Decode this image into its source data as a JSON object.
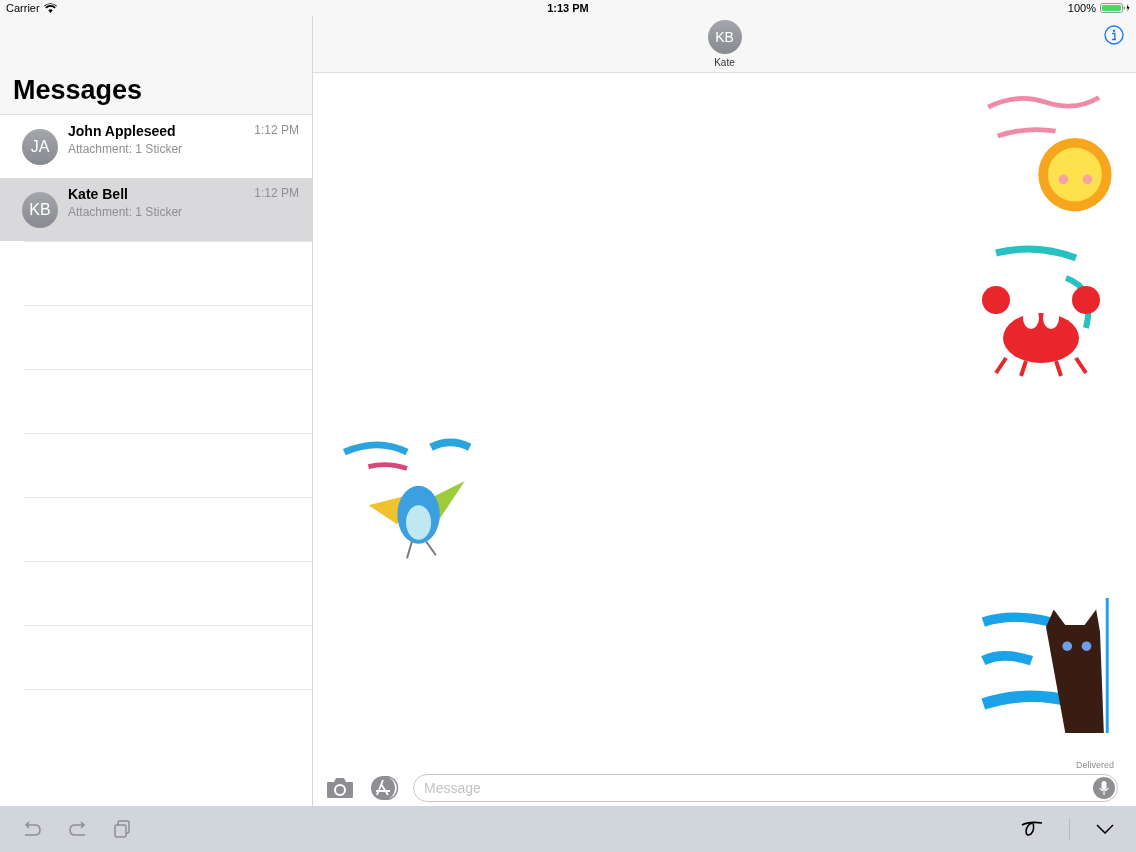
{
  "status_bar": {
    "carrier": "Carrier",
    "time": "1:13 PM",
    "battery": "100%"
  },
  "sidebar": {
    "title": "Messages",
    "conversations": [
      {
        "initials": "JA",
        "name": "John Appleseed",
        "preview": "Attachment: 1 Sticker",
        "time": "1:12 PM",
        "selected": false
      },
      {
        "initials": "KB",
        "name": "Kate Bell",
        "preview": "Attachment: 1 Sticker",
        "time": "1:12 PM",
        "selected": true
      }
    ]
  },
  "conversation": {
    "initials": "KB",
    "name": "Kate",
    "messages": [
      {
        "kind": "picture",
        "outgoing": true
      },
      {
        "kind": "picture",
        "outgoing": true
      },
      {
        "kind": "picture",
        "outgoing": false
      },
      {
        "kind": "picture",
        "outgoing": true
      }
    ],
    "receipt": "Delivered"
  },
  "composer": {
    "placeholder": "Message"
  }
}
